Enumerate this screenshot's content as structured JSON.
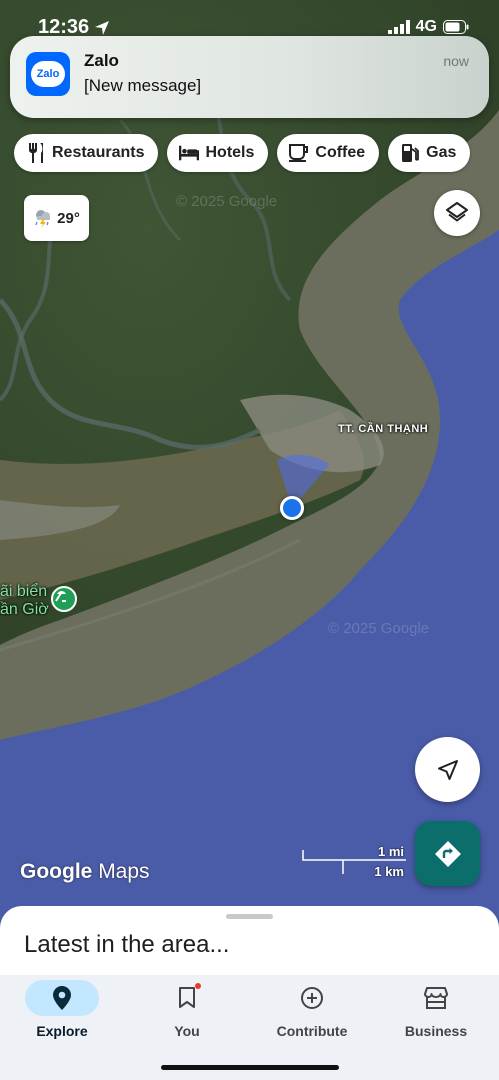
{
  "status_bar": {
    "time": "12:36",
    "network": "4G",
    "battery_icon": "battery-icon"
  },
  "notification": {
    "app_name": "Zalo",
    "icon_text": "Zalo",
    "message": "[New message]",
    "time": "now"
  },
  "chips": [
    {
      "label": "Restaurants",
      "icon": "restaurant-icon"
    },
    {
      "label": "Hotels",
      "icon": "hotel-icon"
    },
    {
      "label": "Coffee",
      "icon": "coffee-icon"
    },
    {
      "label": "Gas",
      "icon": "gas-icon"
    }
  ],
  "weather": {
    "temperature": "29°",
    "icon": "thunderstorm-icon"
  },
  "map": {
    "watermark": "© 2025 Google",
    "place_label": "TT. CẦN THẠNH",
    "poi_label_line1": "ãi biển",
    "poi_label_line2": "ần Giờ",
    "colors": {
      "sea": "#4a5ba8",
      "mud": "#6b6e5c",
      "land": "#3d5232",
      "user_dot": "#1a73e8"
    }
  },
  "logo": {
    "google": "Google",
    "maps": "Maps"
  },
  "scale": {
    "miles": "1 mi",
    "km": "1 km"
  },
  "sheet": {
    "title": "Latest in the area..."
  },
  "nav": [
    {
      "label": "Explore",
      "icon": "location-pin-icon",
      "active": true
    },
    {
      "label": "You",
      "icon": "bookmark-icon",
      "active": false
    },
    {
      "label": "Contribute",
      "icon": "add-circle-icon",
      "active": false
    },
    {
      "label": "Business",
      "icon": "storefront-icon",
      "active": false
    }
  ],
  "colors": {
    "directions_button": "#0b6e6b",
    "nav_active_pill": "#c2e7ff"
  }
}
